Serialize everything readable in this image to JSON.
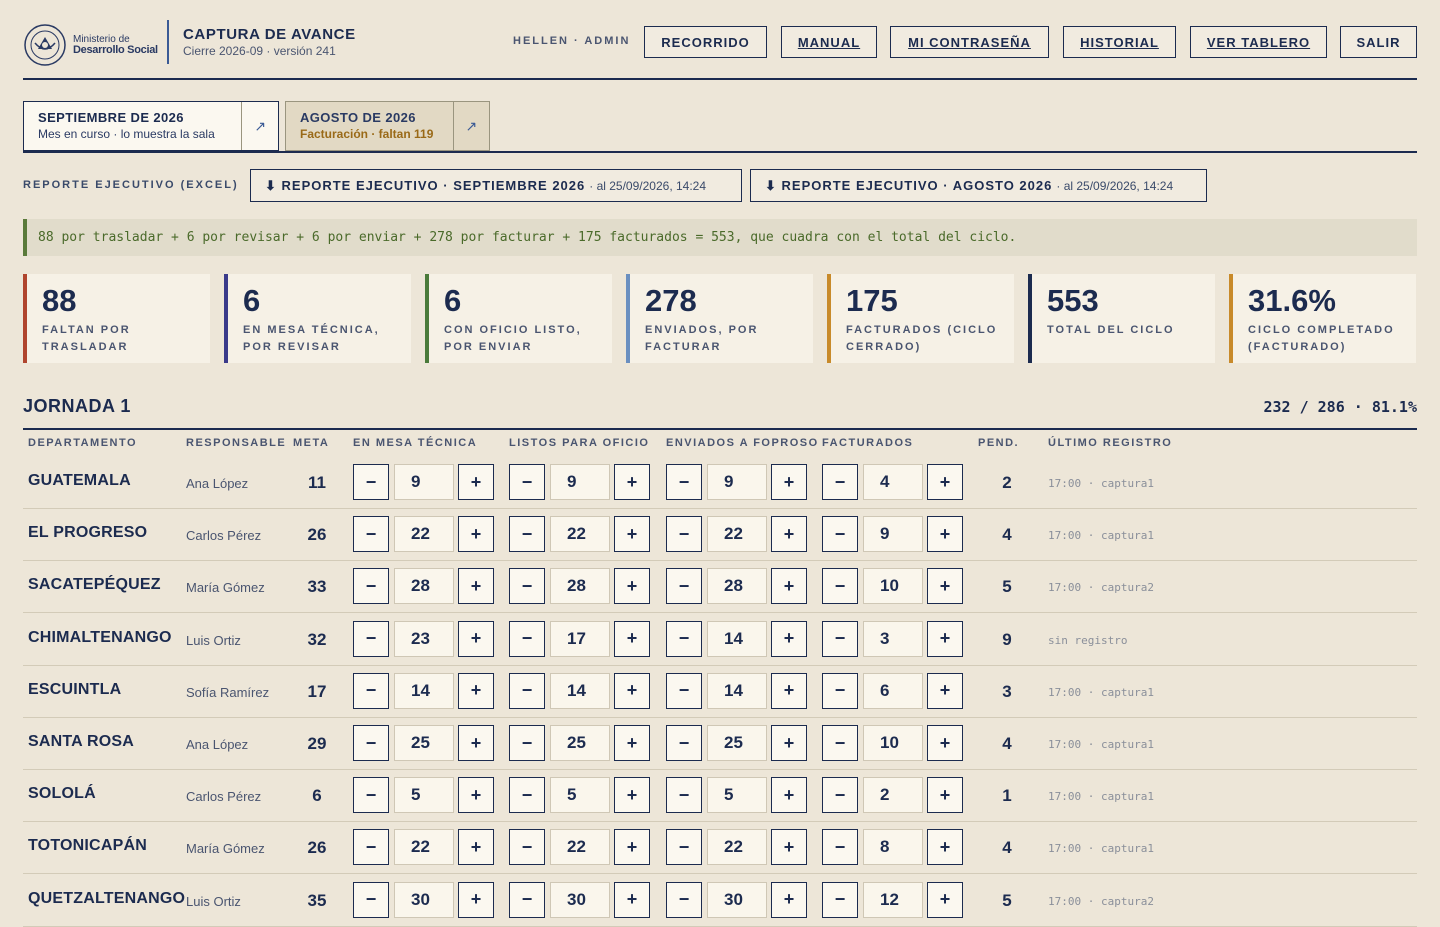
{
  "header": {
    "logo_line1": "Ministerio de",
    "logo_line2": "Desarrollo Social",
    "title": "CAPTURA DE AVANCE",
    "subtitle": "Cierre 2026-09 · versión 241",
    "user": "HELLEN · ADMIN",
    "nav": [
      "RECORRIDO",
      "MANUAL",
      "MI CONTRASEÑA",
      "HISTORIAL",
      "VER TABLERO",
      "SALIR"
    ]
  },
  "tabs": [
    {
      "title": "SEPTIEMBRE DE 2026",
      "sub": "Mes en curso · lo muestra la sala",
      "arrow": "↗"
    },
    {
      "title": "AGOSTO DE 2026",
      "sub": "Facturación · faltan 119",
      "arrow": "↗"
    }
  ],
  "reports": {
    "label": "REPORTE EJECUTIVO (EXCEL)",
    "buttons": [
      {
        "label": "⬇ REPORTE EJECUTIVO · SEPTIEMBRE 2026",
        "date": "· al 25/09/2026, 14:24"
      },
      {
        "label": "⬇ REPORTE EJECUTIVO · AGOSTO 2026",
        "date": "· al 25/09/2026, 14:24"
      }
    ]
  },
  "check_message": "88 por trasladar + 6 por revisar + 6 por enviar + 278 por facturar + 175 facturados = 553, que cuadra con el total del ciclo.",
  "stats": [
    {
      "value": "88",
      "label": "FALTAN POR TRASLADAR",
      "color": "#b0452e"
    },
    {
      "value": "6",
      "label": "EN MESA TÉCNICA, POR REVISAR",
      "color": "#3a3a8a"
    },
    {
      "value": "6",
      "label": "CON OFICIO LISTO, POR ENVIAR",
      "color": "#4a7a3a"
    },
    {
      "value": "278",
      "label": "ENVIADOS, POR FACTURAR",
      "color": "#6a8fc0"
    },
    {
      "value": "175",
      "label": "FACTURADOS (CICLO CERRADO)",
      "color": "#c88a2a"
    },
    {
      "value": "553",
      "label": "TOTAL DEL CICLO",
      "color": "#1c2b4f"
    },
    {
      "value": "31.6%",
      "label": "CICLO COMPLETADO (FACTURADO)",
      "color": "#c88a2a"
    }
  ],
  "jornada": {
    "title": "JORNADA 1",
    "summary": "232 / 286 · 81.1%",
    "columns": [
      "DEPARTAMENTO",
      "RESPONSABLE",
      "META",
      "EN MESA TÉCNICA",
      "LISTOS PARA OFICIO",
      "ENVIADOS A FOPROSO",
      "FACTURADOS",
      "PEND.",
      "ÚLTIMO REGISTRO"
    ],
    "minus": "−",
    "plus": "+",
    "rows": [
      {
        "dept": "GUATEMALA",
        "resp": "Ana López",
        "meta": "11",
        "mesa": "9",
        "listos": "9",
        "enviados": "9",
        "facturados": "4",
        "pend": "2",
        "last": "17:00 · captura1"
      },
      {
        "dept": "EL PROGRESO",
        "resp": "Carlos Pérez",
        "meta": "26",
        "mesa": "22",
        "listos": "22",
        "enviados": "22",
        "facturados": "9",
        "pend": "4",
        "last": "17:00 · captura1"
      },
      {
        "dept": "SACATEPÉQUEZ",
        "resp": "María Gómez",
        "meta": "33",
        "mesa": "28",
        "listos": "28",
        "enviados": "28",
        "facturados": "10",
        "pend": "5",
        "last": "17:00 · captura2"
      },
      {
        "dept": "CHIMALTENANGO",
        "resp": "Luis Ortiz",
        "meta": "32",
        "mesa": "23",
        "listos": "17",
        "enviados": "14",
        "facturados": "3",
        "pend": "9",
        "last": "sin registro"
      },
      {
        "dept": "ESCUINTLA",
        "resp": "Sofía Ramírez",
        "meta": "17",
        "mesa": "14",
        "listos": "14",
        "enviados": "14",
        "facturados": "6",
        "pend": "3",
        "last": "17:00 · captura1"
      },
      {
        "dept": "SANTA ROSA",
        "resp": "Ana López",
        "meta": "29",
        "mesa": "25",
        "listos": "25",
        "enviados": "25",
        "facturados": "10",
        "pend": "4",
        "last": "17:00 · captura1"
      },
      {
        "dept": "SOLOLÁ",
        "resp": "Carlos Pérez",
        "meta": "6",
        "mesa": "5",
        "listos": "5",
        "enviados": "5",
        "facturados": "2",
        "pend": "1",
        "last": "17:00 · captura1"
      },
      {
        "dept": "TOTONICAPÁN",
        "resp": "María Gómez",
        "meta": "26",
        "mesa": "22",
        "listos": "22",
        "enviados": "22",
        "facturados": "8",
        "pend": "4",
        "last": "17:00 · captura1"
      },
      {
        "dept": "QUETZALTENANGO",
        "resp": "Luis Ortiz",
        "meta": "35",
        "mesa": "30",
        "listos": "30",
        "enviados": "30",
        "facturados": "12",
        "pend": "5",
        "last": "17:00 · captura2"
      }
    ]
  }
}
